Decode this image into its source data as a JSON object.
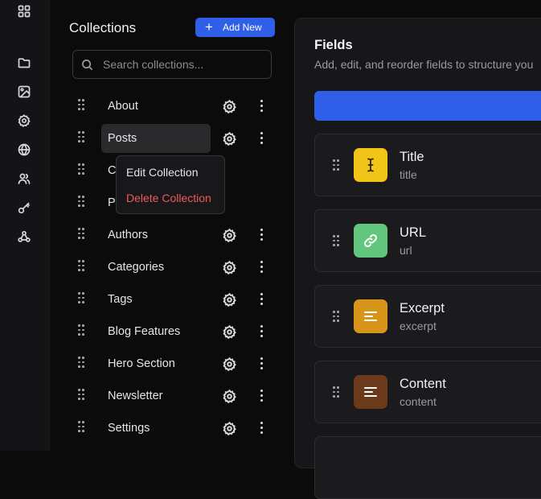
{
  "rail": {
    "icons": [
      "grid-icon",
      "folder-icon",
      "image-icon",
      "settings-icon",
      "globe-icon",
      "users-icon",
      "key-icon",
      "webhook-icon"
    ]
  },
  "collections": {
    "title": "Collections",
    "add_label": "Add New",
    "search_placeholder": "Search collections...",
    "items": [
      {
        "label": "About"
      },
      {
        "label": "Posts"
      },
      {
        "label": "Comments"
      },
      {
        "label": "Pages"
      },
      {
        "label": "Authors"
      },
      {
        "label": "Categories"
      },
      {
        "label": "Tags"
      },
      {
        "label": "Blog Features"
      },
      {
        "label": "Hero Section"
      },
      {
        "label": "Newsletter"
      },
      {
        "label": "Settings"
      }
    ],
    "active_index": 1
  },
  "context_menu": {
    "edit_label": "Edit Collection",
    "delete_label": "Delete Collection"
  },
  "fields_panel": {
    "title": "Fields",
    "subtitle": "Add, edit, and reorder fields to structure you",
    "fields": [
      {
        "name": "Title",
        "key": "title",
        "icon": "text-cursor-icon",
        "color": "#f2c418"
      },
      {
        "name": "URL",
        "key": "url",
        "icon": "link-icon",
        "color": "#62c77c"
      },
      {
        "name": "Excerpt",
        "key": "excerpt",
        "icon": "align-left-icon",
        "color": "#d7961a"
      },
      {
        "name": "Content",
        "key": "content",
        "icon": "align-left-icon",
        "color": "#6b3a1a"
      }
    ]
  },
  "colors": {
    "accent": "#2f5fe8",
    "danger": "#ee5a5a",
    "background": "#0b0b0c"
  }
}
